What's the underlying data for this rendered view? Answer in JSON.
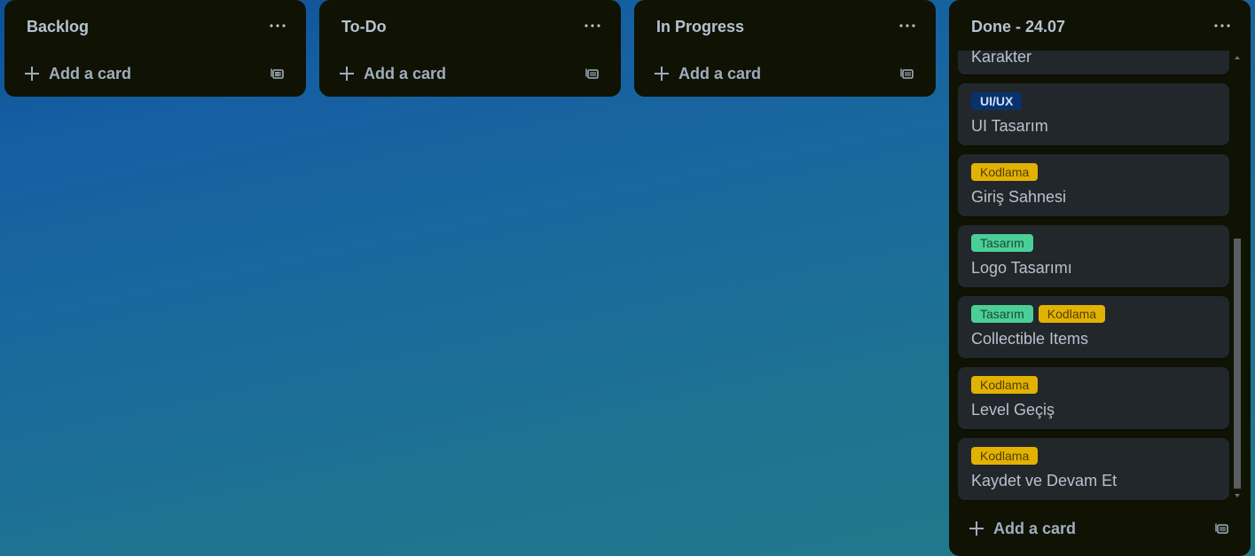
{
  "lists": [
    {
      "title": "Backlog",
      "add_label": "Add a card"
    },
    {
      "title": "To-Do",
      "add_label": "Add a card"
    },
    {
      "title": "In Progress",
      "add_label": "Add a card"
    },
    {
      "title": "Done - 24.07",
      "add_label": "Add a card"
    }
  ],
  "done_cards": [
    {
      "labels": [],
      "title": "Karakter"
    },
    {
      "labels": [
        {
          "text": "UI/UX",
          "kind": "uiux"
        }
      ],
      "title": "UI Tasarım"
    },
    {
      "labels": [
        {
          "text": "Kodlama",
          "kind": "kodlama"
        }
      ],
      "title": "Giriş Sahnesi"
    },
    {
      "labels": [
        {
          "text": "Tasarım",
          "kind": "tasarim"
        }
      ],
      "title": "Logo Tasarımı"
    },
    {
      "labels": [
        {
          "text": "Tasarım",
          "kind": "tasarim"
        },
        {
          "text": "Kodlama",
          "kind": "kodlama"
        }
      ],
      "title": "Collectible Items"
    },
    {
      "labels": [
        {
          "text": "Kodlama",
          "kind": "kodlama"
        }
      ],
      "title": "Level Geçiş"
    },
    {
      "labels": [
        {
          "text": "Kodlama",
          "kind": "kodlama"
        }
      ],
      "title": "Kaydet ve Devam Et"
    }
  ],
  "colors": {
    "list_bg": "#101204",
    "card_bg": "#22272b",
    "kodlama": "#e2b203",
    "tasarim": "#4bce97",
    "uiux": "#09326c"
  },
  "icons": {
    "menu": "more-dots-icon",
    "add": "plus-icon",
    "template": "card-template-icon"
  }
}
